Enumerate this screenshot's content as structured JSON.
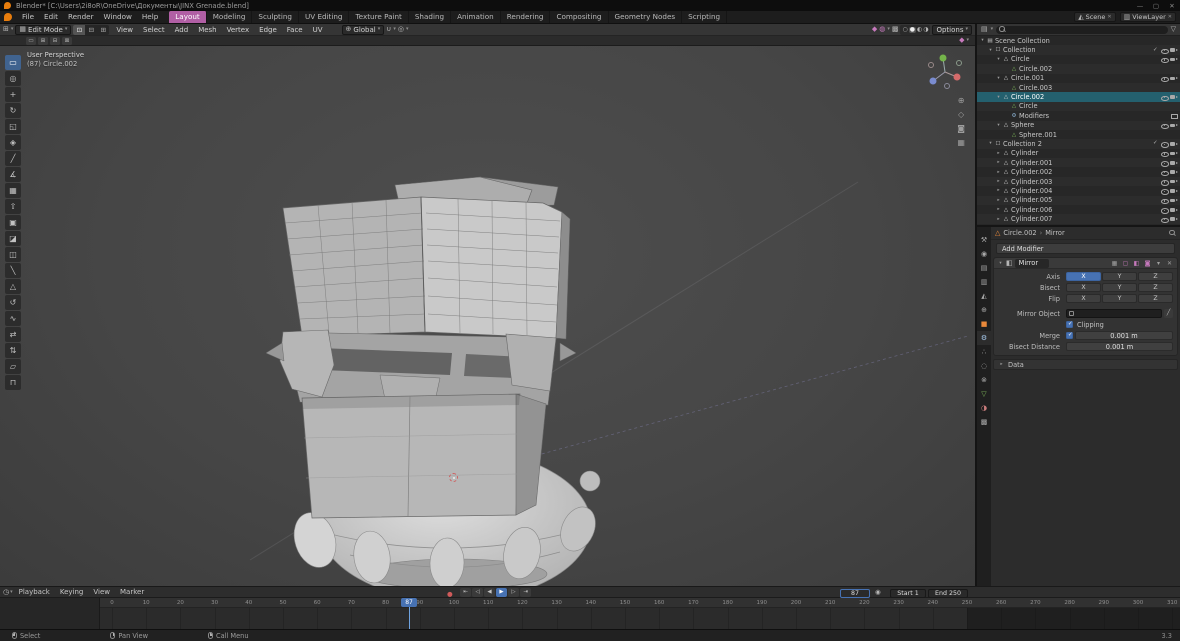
{
  "colors": {
    "accent_blue": "#4772b3",
    "accent_pink": "#b15fa5",
    "selection_teal": "#24606e",
    "object_orange": "#e8883a",
    "data_green": "#7fba5a",
    "viewport_gray": "#464646"
  },
  "titlebar": {
    "title": "Blender*  [C:\\Users\\2i8oR\\OneDrive\\Документы\\JINX Grenade.blend]",
    "minimize": "—",
    "maximize": "▢",
    "close": "✕"
  },
  "topbar": {
    "menus": [
      "File",
      "Edit",
      "Render",
      "Window",
      "Help"
    ],
    "workspaces": [
      "Layout",
      "Modeling",
      "Sculpting",
      "UV Editing",
      "Texture Paint",
      "Shading",
      "Animation",
      "Rendering",
      "Compositing",
      "Geometry Nodes",
      "Scripting"
    ],
    "active_workspace": "Layout",
    "scene": "Scene",
    "view_layer": "ViewLayer"
  },
  "viewport_header": {
    "mode": "Edit Mode",
    "menus": [
      "View",
      "Select",
      "Add",
      "Mesh",
      "Vertex",
      "Edge",
      "Face",
      "UV"
    ],
    "orientation": "Global",
    "options_label": "Options"
  },
  "viewport": {
    "overlay_line1": "User Perspective",
    "overlay_line2": "(87) Circle.002"
  },
  "toolbar": {
    "active_tool": "select-box",
    "tools": [
      "select-box",
      "cursor",
      "move",
      "rotate",
      "scale",
      "transform",
      "annotate",
      "measure",
      "add-cube",
      "extrude",
      "inset-faces",
      "bevel",
      "loop-cut",
      "knife",
      "poly-build",
      "spin",
      "smooth",
      "edge-slide",
      "shrink-fatten",
      "shear",
      "rip-region"
    ]
  },
  "outliner": {
    "search_placeholder": "",
    "rows": [
      {
        "label": "Scene Collection",
        "indent": 0,
        "icon": "scene-collection",
        "arrow": "down",
        "right": []
      },
      {
        "label": "Collection",
        "indent": 1,
        "icon": "collection",
        "arrow": "down",
        "right": [
          "chk",
          "eye",
          "cam"
        ]
      },
      {
        "label": "Circle",
        "indent": 2,
        "icon": "object",
        "arrow": "down",
        "right": [
          "eye",
          "cam"
        ]
      },
      {
        "label": "Circle.002",
        "indent": 3,
        "icon": "data",
        "arrow": null,
        "right": []
      },
      {
        "label": "Circle.001",
        "indent": 2,
        "icon": "object",
        "arrow": "down",
        "right": [
          "eye",
          "cam"
        ]
      },
      {
        "label": "Circle.003",
        "indent": 3,
        "icon": "data",
        "arrow": null,
        "right": []
      },
      {
        "label": "Circle.002",
        "indent": 2,
        "icon": "object",
        "arrow": "down",
        "selected": true,
        "right": [
          "eye",
          "cam"
        ]
      },
      {
        "label": "Circle",
        "indent": 3,
        "icon": "data",
        "arrow": null,
        "right": []
      },
      {
        "label": "Modifiers",
        "indent": 3,
        "icon": "modifier",
        "arrow": null,
        "right": [
          "screen"
        ]
      },
      {
        "label": "Sphere",
        "indent": 2,
        "icon": "object",
        "arrow": "down",
        "right": [
          "eye",
          "cam"
        ]
      },
      {
        "label": "Sphere.001",
        "indent": 3,
        "icon": "data",
        "arrow": null,
        "right": []
      },
      {
        "label": "Collection 2",
        "indent": 1,
        "icon": "collection",
        "arrow": "down",
        "right": [
          "chk",
          "eye",
          "cam"
        ]
      },
      {
        "label": "Cylinder",
        "indent": 2,
        "icon": "object",
        "arrow": "right",
        "right": [
          "eye",
          "cam"
        ]
      },
      {
        "label": "Cylinder.001",
        "indent": 2,
        "icon": "object",
        "arrow": "right",
        "right": [
          "eye",
          "cam"
        ]
      },
      {
        "label": "Cylinder.002",
        "indent": 2,
        "icon": "object",
        "arrow": "right",
        "right": [
          "eye",
          "cam"
        ]
      },
      {
        "label": "Cylinder.003",
        "indent": 2,
        "icon": "object",
        "arrow": "right",
        "right": [
          "eye",
          "cam"
        ]
      },
      {
        "label": "Cylinder.004",
        "indent": 2,
        "icon": "object",
        "arrow": "right",
        "right": [
          "eye",
          "cam"
        ]
      },
      {
        "label": "Cylinder.005",
        "indent": 2,
        "icon": "object",
        "arrow": "right",
        "right": [
          "eye",
          "cam"
        ]
      },
      {
        "label": "Cylinder.006",
        "indent": 2,
        "icon": "object",
        "arrow": "right",
        "right": [
          "eye",
          "cam"
        ]
      },
      {
        "label": "Cylinder.007",
        "indent": 2,
        "icon": "object",
        "arrow": "right",
        "right": [
          "eye",
          "cam"
        ]
      }
    ]
  },
  "properties": {
    "tabs": [
      "tool",
      "render",
      "output",
      "view-layer",
      "scene",
      "world",
      "object",
      "modifiers",
      "particles",
      "physics",
      "constraints",
      "object-data",
      "material",
      "texture"
    ],
    "active_tab": "modifiers",
    "breadcrumb": {
      "object": "Circle.002",
      "separator": "›",
      "item": "Mirror"
    },
    "add_modifier_label": "Add Modifier",
    "modifier": {
      "name": "Mirror",
      "axis_label": "Axis",
      "axis_buttons": [
        {
          "label": "X",
          "on": true
        },
        {
          "label": "Y",
          "on": false
        },
        {
          "label": "Z",
          "on": false
        }
      ],
      "bisect_label": "Bisect",
      "bisect_buttons": [
        {
          "label": "X",
          "on": false
        },
        {
          "label": "Y",
          "on": false
        },
        {
          "label": "Z",
          "on": false
        }
      ],
      "flip_label": "Flip",
      "flip_buttons": [
        {
          "label": "X",
          "on": false
        },
        {
          "label": "Y",
          "on": false
        },
        {
          "label": "Z",
          "on": false
        }
      ],
      "mirror_object_label": "Mirror Object",
      "mirror_object_value": "",
      "clipping_label": "Clipping",
      "clipping_checked": true,
      "merge_label": "Merge",
      "merge_checked": true,
      "merge_value": "0.001 m",
      "bisect_distance_label": "Bisect Distance",
      "bisect_distance_value": "0.001 m",
      "data_label": "Data"
    }
  },
  "timeline": {
    "menus": [
      "Playback",
      "Keying",
      "View",
      "Marker"
    ],
    "transport": [
      "jump-start",
      "prev-keyframe",
      "play-reverse",
      "play",
      "next-keyframe",
      "jump-end"
    ],
    "current_frame": "87",
    "playhead_frame": 87,
    "playhead_label": "87",
    "start_label": "Start",
    "start_value": "1",
    "end_label": "End",
    "end_value": "250",
    "ticks": [
      0,
      10,
      20,
      30,
      40,
      50,
      60,
      70,
      80,
      90,
      100,
      110,
      120,
      130,
      140,
      150,
      160,
      170,
      180,
      190,
      200,
      210,
      220,
      230,
      240,
      250,
      260,
      270,
      280,
      290,
      300,
      310
    ]
  },
  "statusbar": {
    "hints": [
      {
        "icon": "mouse-left",
        "label": "Select"
      },
      {
        "icon": "mouse-middle",
        "label": "Pan View"
      },
      {
        "icon": "mouse-right",
        "label": "Call Menu"
      }
    ],
    "version": "3.3"
  },
  "icons": {
    "dropdown": "▾",
    "arrow-right": "▸",
    "arrow-down": "▾",
    "close": "✕",
    "editor-3d-view": "⊞",
    "edit-mode-cube": "▦",
    "vertex-select": "⊡",
    "edge-select": "⊟",
    "face-select": "⊞",
    "orientation-global": "⊕",
    "snap-magnet": "∪",
    "proportional": "◎",
    "gizmo": "◆",
    "overlays": "◍",
    "xray": "▩",
    "shade-wireframe": "○",
    "shade-solid": "●",
    "shade-material": "◐",
    "shade-rendered": "◑",
    "filter": "▽",
    "scene-collection": "▤",
    "collection": "☐",
    "object": "△",
    "data": "△",
    "modifier": "⚙",
    "editor-timeline": "◷",
    "record": "●",
    "keying": "◉",
    "mirror-modifier": "◧",
    "wrench": "⚙",
    "eyedropper": "╱",
    "mod-toggle-cage": "▦",
    "mod-toggle-edit": "▢",
    "mod-toggle-realtime": "◧",
    "mod-toggle-render": "◙",
    "zoom": "⊕",
    "pan": "◇",
    "view-camera": "◙",
    "persp": "▦",
    "tool-select-box": "▭",
    "tool-cursor": "◎",
    "tool-move": "+",
    "tool-rotate": "↻",
    "tool-scale": "◱",
    "tool-transform": "◈",
    "tool-annotate": "╱",
    "tool-measure": "∡",
    "tool-add-cube": "▦",
    "tool-extrude": "⇧",
    "tool-inset-faces": "▣",
    "tool-bevel": "◪",
    "tool-loop-cut": "◫",
    "tool-knife": "╲",
    "tool-poly-build": "△",
    "tool-spin": "↺",
    "tool-smooth": "∿",
    "tool-edge-slide": "⇄",
    "tool-shrink-fatten": "⇅",
    "tool-shear": "▱",
    "tool-rip-region": "⊓",
    "tab-tool": "⚒",
    "tab-render": "◉",
    "tab-output": "▤",
    "tab-view-layer": "▥",
    "tab-scene": "◭",
    "tab-world": "⊕",
    "tab-object": "■",
    "tab-modifiers": "⚙",
    "tab-particles": "∴",
    "tab-physics": "◌",
    "tab-constraints": "⊗",
    "tab-object-data": "▽",
    "tab-material": "◑",
    "tab-texture": "▩",
    "transport-jump-start": "⇤",
    "transport-prev-keyframe": "◁",
    "transport-play-reverse": "◀",
    "transport-play": "▶",
    "transport-next-keyframe": "▷",
    "transport-jump-end": "⇥",
    "tool-opt-new": "▭",
    "tool-opt-extend": "⊞",
    "tool-opt-subtract": "⊟",
    "tool-opt-intersect": "⊠"
  }
}
